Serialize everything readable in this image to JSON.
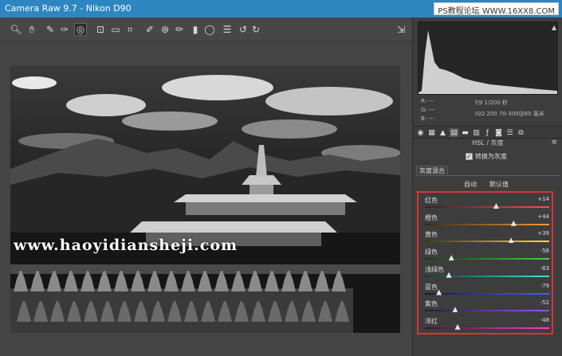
{
  "titlebar": {
    "title": "Camera Raw 9.7 -  Nikon D90",
    "watermark": "PS教程论坛 WWW.16XX8.COM"
  },
  "toolbar": {
    "tools": [
      {
        "name": "zoom-icon",
        "glyph": "🔍︎"
      },
      {
        "name": "hand-icon",
        "glyph": "✋︎"
      },
      {
        "name": "white-balance-icon",
        "glyph": "✎"
      },
      {
        "name": "color-sampler-icon",
        "glyph": "✑"
      },
      {
        "name": "targeted-adjustment-icon",
        "glyph": "◎"
      },
      {
        "name": "crop-icon",
        "glyph": "⊡"
      },
      {
        "name": "straighten-icon",
        "glyph": "▭"
      },
      {
        "name": "transform-icon",
        "glyph": "⌗"
      },
      {
        "name": "spot-removal-icon",
        "glyph": "✐"
      },
      {
        "name": "red-eye-icon",
        "glyph": "⊛"
      },
      {
        "name": "adjustment-brush-icon",
        "glyph": "✏"
      },
      {
        "name": "graduated-filter-icon",
        "glyph": "▮"
      },
      {
        "name": "radial-filter-icon",
        "glyph": "◯"
      },
      {
        "name": "preferences-icon",
        "glyph": "☰"
      },
      {
        "name": "rotate-left-icon",
        "glyph": "↺"
      },
      {
        "name": "rotate-right-icon",
        "glyph": "↻"
      },
      {
        "name": "fullscreen-icon",
        "glyph": "⇲"
      }
    ]
  },
  "watermark_site": "www.haoyidiansheji.com",
  "info": {
    "r": "R:  ---",
    "g": "G:  ---",
    "b": "B:  ---",
    "exposure": "f/9    1/200 秒",
    "iso": "ISO 200    70-300@80 毫米"
  },
  "panel": {
    "section_title": "HSL / 灰度",
    "convert_label": "转换为灰度",
    "convert_checked": "✓",
    "subtab_label": "灰度混合",
    "auto_label": "自动",
    "default_label": "默认值"
  },
  "sliders": [
    {
      "label": "红色",
      "value": "+14",
      "fraction": 0.57,
      "colors": [
        "#3a2020",
        "#ff5050"
      ]
    },
    {
      "label": "橙色",
      "value": "+44",
      "fraction": 0.71,
      "colors": [
        "#3a2a18",
        "#ff9a30"
      ]
    },
    {
      "label": "黄色",
      "value": "+39",
      "fraction": 0.69,
      "colors": [
        "#3a3a18",
        "#ffe040"
      ]
    },
    {
      "label": "绿色",
      "value": "-58",
      "fraction": 0.21,
      "colors": [
        "#183a18",
        "#40d040"
      ]
    },
    {
      "label": "浅绿色",
      "value": "-63",
      "fraction": 0.19,
      "colors": [
        "#183a3a",
        "#40e0e0"
      ]
    },
    {
      "label": "蓝色",
      "value": "-79",
      "fraction": 0.11,
      "colors": [
        "#18183a",
        "#4060ff"
      ]
    },
    {
      "label": "紫色",
      "value": "-52",
      "fraction": 0.24,
      "colors": [
        "#28183a",
        "#a050ff"
      ]
    },
    {
      "label": "洋红",
      "value": "-48",
      "fraction": 0.26,
      "colors": [
        "#3a1830",
        "#ff40c0"
      ]
    }
  ],
  "colors": {
    "titlebar": "#2e86c1",
    "highlight_box": "#dd3333"
  }
}
